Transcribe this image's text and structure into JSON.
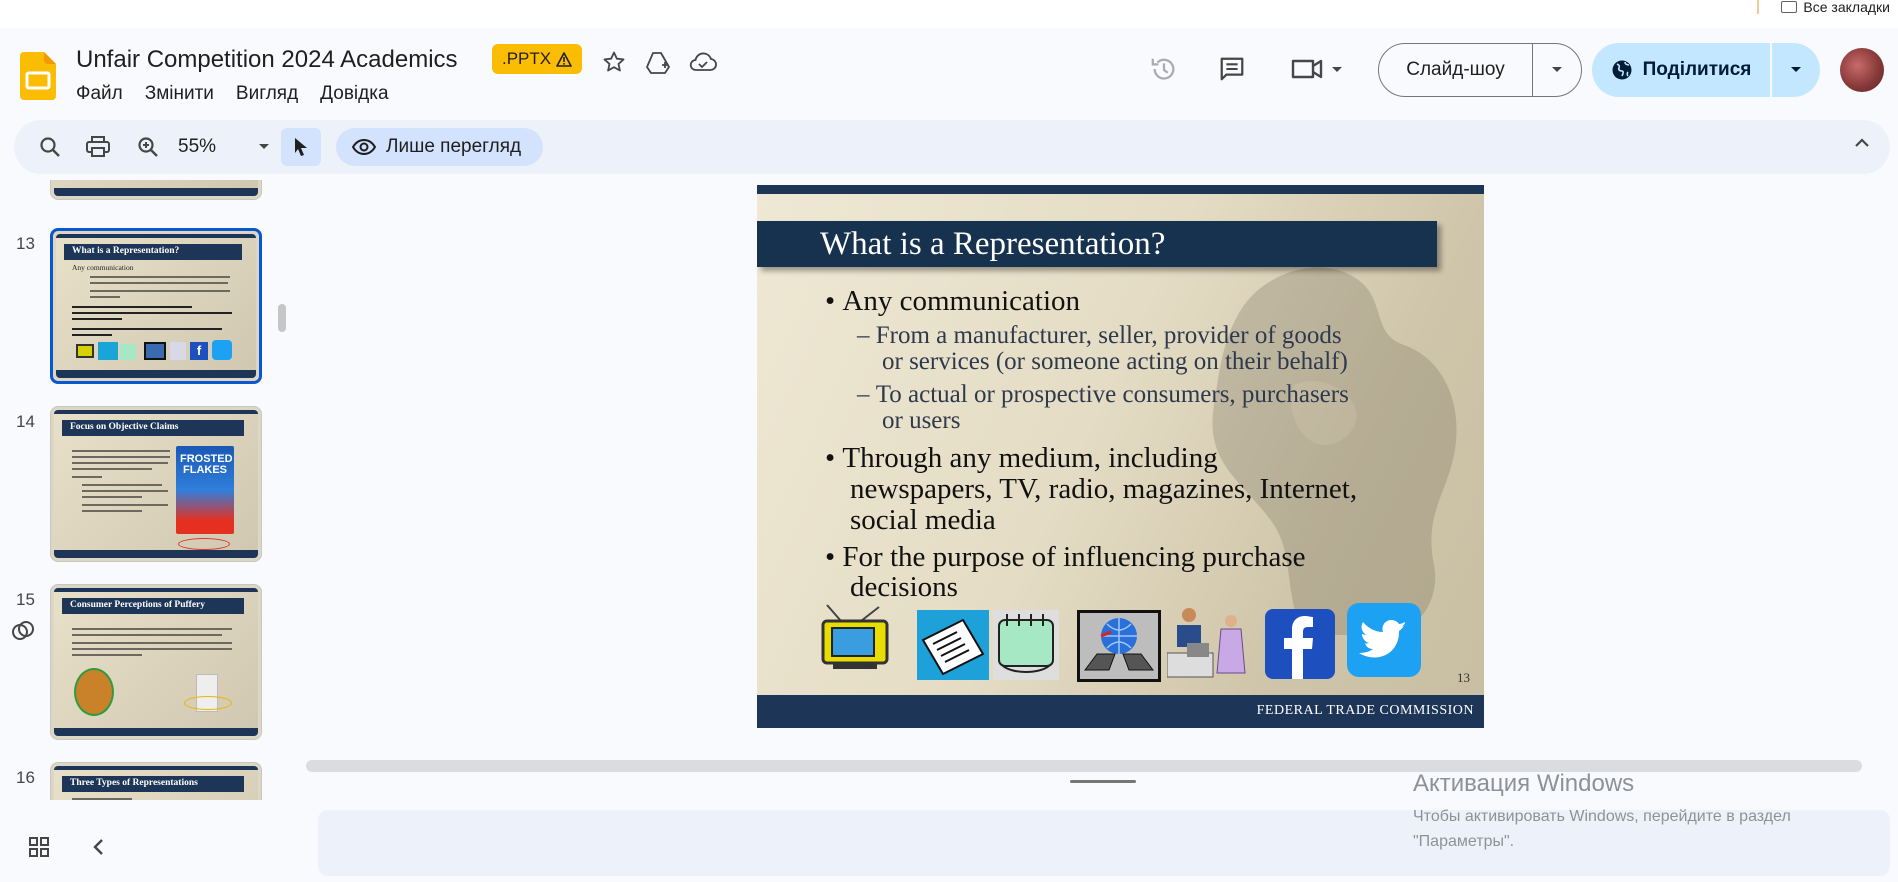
{
  "browser": {
    "bookmarks_label": "Все закладки"
  },
  "header": {
    "doc_title": "Unfair Competition 2024 Academics",
    "file_badge": ".PPTX",
    "menu": [
      "Файл",
      "Змінити",
      "Вигляд",
      "Довідка"
    ],
    "slideshow_label": "Слайд-шоу",
    "share_label": "Поділитися"
  },
  "toolbar": {
    "zoom": "55%",
    "view_only_label": "Лише перегляд"
  },
  "filmstrip": {
    "slides": [
      {
        "number": "13",
        "title": "What is a Representation?",
        "selected": true
      },
      {
        "number": "14",
        "title": "Focus on Objective Claims",
        "selected": false
      },
      {
        "number": "15",
        "title": "Consumer Perceptions of Puffery",
        "selected": false
      },
      {
        "number": "16",
        "title": "Three Types of Representations",
        "selected": false
      }
    ]
  },
  "slide": {
    "title": "What is a Representation?",
    "bullets": [
      {
        "text": "Any communication",
        "subs": [
          "From a manufacturer, seller, provider of goods",
          "or services (or someone acting on their behalf)",
          "To actual or prospective consumers, purchasers",
          "or users"
        ]
      },
      {
        "text_lines": [
          "Through any medium, including",
          "newspapers, TV, radio, magazines, Internet,",
          "social media"
        ]
      },
      {
        "text_lines": [
          "For the purpose of influencing purchase",
          "decisions"
        ]
      }
    ],
    "bullet_char": "•",
    "dash_char": "–",
    "number": "13",
    "footer": "FEDERAL TRADE COMMISSION"
  },
  "activation": {
    "title": "Активация Windows",
    "line1": "Чтобы активировать Windows, перейдите в раздел",
    "line2": "\"Параметры\"."
  },
  "colors": {
    "accent_blue": "#0b57d0",
    "share_bg": "#c2e7ff",
    "badge_yellow": "#fbbc04",
    "slide_navy": "#1d3557"
  },
  "icons": [
    "folder-icon",
    "slides-logo-icon",
    "warning-icon",
    "star-icon",
    "move-to-drive-icon",
    "cloud-status-icon",
    "history-icon",
    "comment-icon",
    "video-call-icon",
    "globe-icon",
    "search-icon",
    "print-icon",
    "zoom-icon",
    "cursor-icon",
    "eye-icon",
    "chevron-up-icon",
    "grid-icon",
    "chevron-left-icon"
  ]
}
